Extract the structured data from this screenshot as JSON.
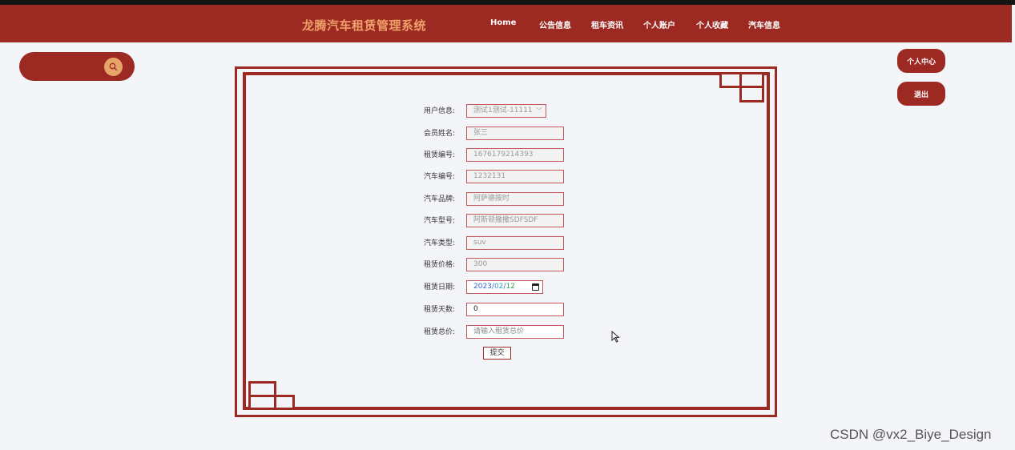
{
  "header": {
    "brand": "龙腾汽车租赁管理系统",
    "nav": [
      {
        "label": "Home"
      },
      {
        "label": "公告信息"
      },
      {
        "label": "租车资讯"
      },
      {
        "label": "个人账户"
      },
      {
        "label": "个人收藏"
      },
      {
        "label": "汽车信息"
      }
    ]
  },
  "search": {
    "icon": "search-icon"
  },
  "side_buttons": {
    "personal_center": "个人中心",
    "logout": "退出"
  },
  "form": {
    "fields": [
      {
        "label": "用户信息:",
        "value": "测试1测试-11111",
        "type": "select"
      },
      {
        "label": "会员姓名:",
        "value": "张三",
        "type": "readonly"
      },
      {
        "label": "租赁编号:",
        "value": "1676179214393",
        "type": "readonly"
      },
      {
        "label": "汽车编号:",
        "value": "1232131",
        "type": "readonly"
      },
      {
        "label": "汽车品牌:",
        "value": "阿萨德按时",
        "type": "readonly"
      },
      {
        "label": "汽车型号:",
        "value": "阿斯顿撒撒SDFSDF",
        "type": "readonly"
      },
      {
        "label": "汽车类型:",
        "value": "suv",
        "type": "readonly"
      },
      {
        "label": "租赁价格:",
        "value": "300",
        "type": "readonly"
      },
      {
        "label": "租赁日期:",
        "type": "date",
        "year": "2023",
        "month": "02",
        "day": "12",
        "sep": "/"
      },
      {
        "label": "租赁天数:",
        "value": "0",
        "type": "text"
      },
      {
        "label": "租赁总价:",
        "placeholder": "请输入租赁总价",
        "type": "text"
      }
    ],
    "submit": "提交"
  },
  "watermark": "CSDN @vx2_Biye_Design",
  "colors": {
    "primary": "#9c2a22",
    "brand_text": "#f0a06a",
    "search_button": "#e8a56a",
    "background": "#f3f5f8"
  }
}
